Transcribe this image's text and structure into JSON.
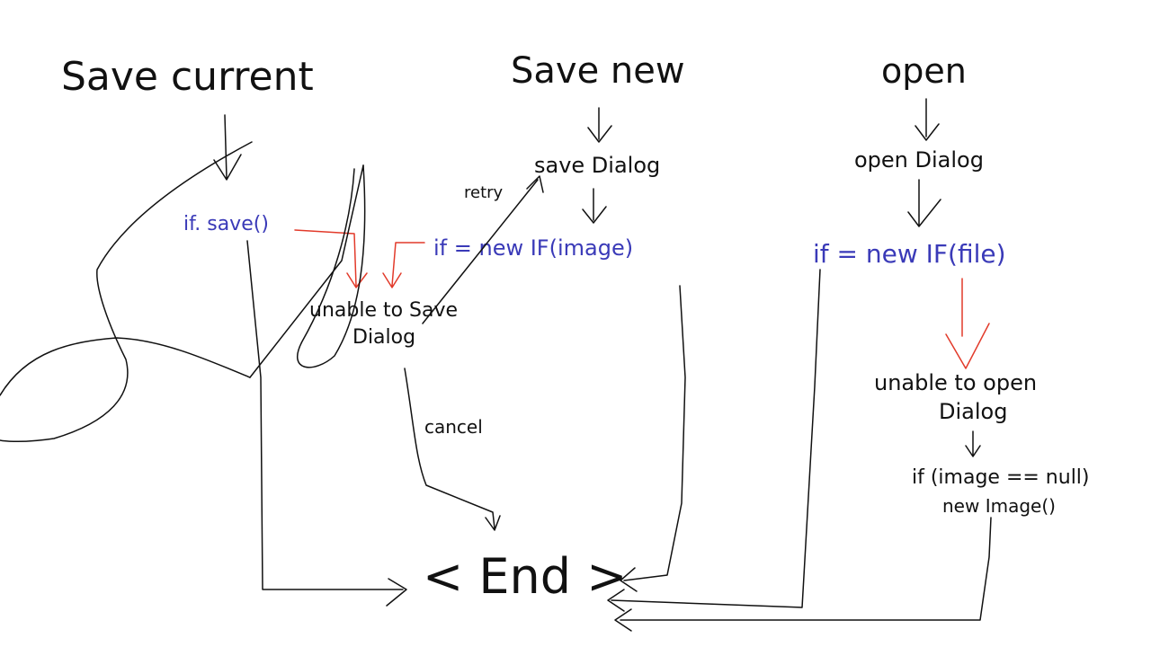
{
  "diagram": {
    "headings": {
      "save_current": "Save current",
      "save_new": "Save new",
      "open": "open"
    },
    "nodes": {
      "save_dialog": "save Dialog",
      "open_dialog": "open Dialog",
      "if_save": "if. save()",
      "if_new_image": "if = new IF(image)",
      "if_new_file": "if = new IF(file)",
      "unable_to_save_line1": "unable to Save",
      "unable_to_save_line2": "Dialog",
      "unable_to_open_line1": "unable to open",
      "unable_to_open_line2": "Dialog",
      "null_check_line1": "if (image == null)",
      "null_check_line2": "new Image()",
      "end": "< End >"
    },
    "edge_labels": {
      "retry": "retry",
      "cancel": "cancel"
    },
    "colors": {
      "ink": "#111111",
      "code": "#3a3ab8",
      "error_arrow": "#e23a2a",
      "background": "#ffffff"
    }
  }
}
